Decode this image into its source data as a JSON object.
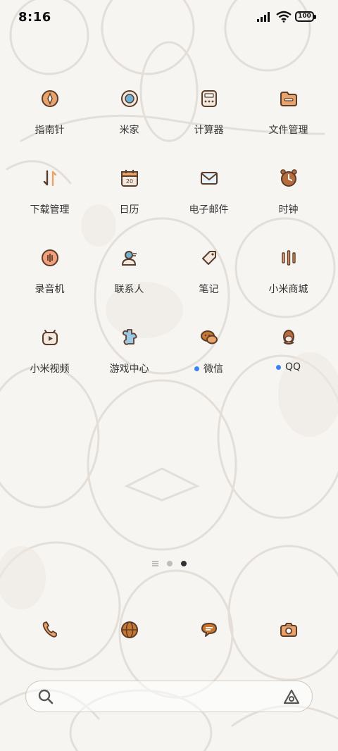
{
  "status_bar": {
    "time": "8:16",
    "battery": "100"
  },
  "apps": [
    {
      "label": "指南针",
      "icon": "compass-icon",
      "dot": false
    },
    {
      "label": "米家",
      "icon": "mijia-icon",
      "dot": false
    },
    {
      "label": "计算器",
      "icon": "calculator-icon",
      "dot": false
    },
    {
      "label": "文件管理",
      "icon": "folder-icon",
      "dot": false
    },
    {
      "label": "下载管理",
      "icon": "download-icon",
      "dot": false
    },
    {
      "label": "日历",
      "icon": "calendar-icon",
      "dot": false,
      "calendar_day": "20"
    },
    {
      "label": "电子邮件",
      "icon": "mail-icon",
      "dot": false
    },
    {
      "label": "时钟",
      "icon": "clock-icon",
      "dot": false
    },
    {
      "label": "录音机",
      "icon": "recorder-icon",
      "dot": false
    },
    {
      "label": "联系人",
      "icon": "contacts-icon",
      "dot": false
    },
    {
      "label": "笔记",
      "icon": "notes-icon",
      "dot": false
    },
    {
      "label": "小米商城",
      "icon": "mall-icon",
      "dot": false
    },
    {
      "label": "小米视频",
      "icon": "video-icon",
      "dot": false
    },
    {
      "label": "游戏中心",
      "icon": "game-center-icon",
      "dot": false
    },
    {
      "label": "微信",
      "icon": "wechat-icon",
      "dot": true
    },
    {
      "label": "QQ",
      "icon": "qq-icon",
      "dot": true
    }
  ],
  "dock": [
    {
      "icon": "phone-icon"
    },
    {
      "icon": "browser-icon"
    },
    {
      "icon": "messages-icon"
    },
    {
      "icon": "camera-icon"
    }
  ],
  "page_indicator": {
    "current": 2,
    "count": 2
  },
  "colors": {
    "icon_stroke": "#5a3d2b",
    "icon_fill": "#e9a36b",
    "dot_blue": "#3b82f6"
  }
}
